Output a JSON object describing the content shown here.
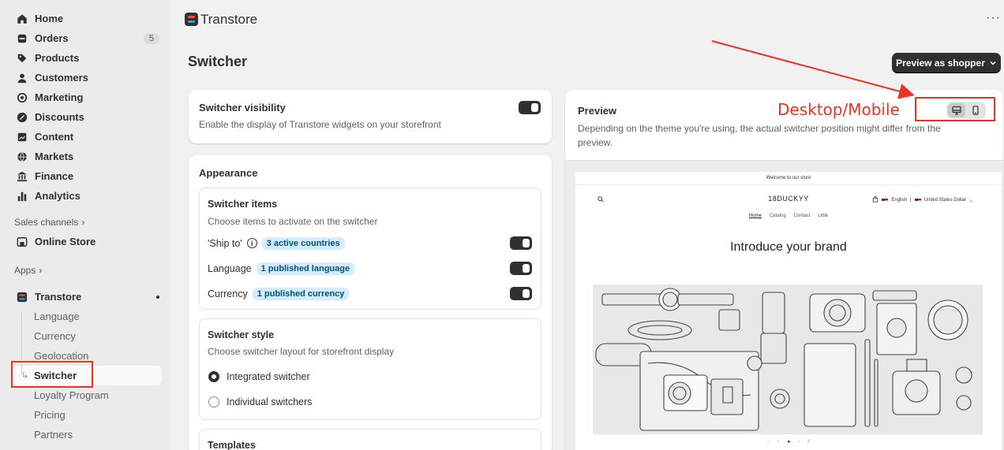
{
  "sidebar": {
    "items": [
      {
        "label": "Home",
        "icon": "home-icon"
      },
      {
        "label": "Orders",
        "icon": "orders-icon",
        "badge": "5"
      },
      {
        "label": "Products",
        "icon": "tag-icon"
      },
      {
        "label": "Customers",
        "icon": "person-icon"
      },
      {
        "label": "Marketing",
        "icon": "target-icon"
      },
      {
        "label": "Discounts",
        "icon": "discount-icon"
      },
      {
        "label": "Content",
        "icon": "content-icon"
      },
      {
        "label": "Markets",
        "icon": "globe-icon"
      },
      {
        "label": "Finance",
        "icon": "bank-icon"
      },
      {
        "label": "Analytics",
        "icon": "bar-chart-icon"
      }
    ],
    "sales_channels_label": "Sales channels",
    "online_store_label": "Online Store",
    "apps_label": "Apps",
    "app_name": "Transtore",
    "app_sub_items": [
      "Language",
      "Currency",
      "Geolocation",
      "Switcher",
      "Loyalty Program",
      "Pricing",
      "Partners"
    ]
  },
  "header": {
    "app_title": "Transtore",
    "more": "···"
  },
  "page": {
    "title": "Switcher",
    "preview_button": "Preview as shopper"
  },
  "visibility_card": {
    "title": "Switcher visibility",
    "desc": "Enable the display of Transtore widgets on your storefront"
  },
  "appearance": {
    "title": "Appearance",
    "items_card": {
      "title": "Switcher items",
      "desc": "Choose items to activate on the switcher",
      "rows": [
        {
          "label": "'Ship to'",
          "pill": "3 active countries"
        },
        {
          "label": "Language",
          "pill": "1 published language"
        },
        {
          "label": "Currency",
          "pill": "1 published currency"
        }
      ]
    },
    "style_card": {
      "title": "Switcher style",
      "desc": "Choose switcher layout for storefront display",
      "options": [
        "Integrated switcher",
        "Individual switchers"
      ]
    },
    "templates_title": "Templates"
  },
  "preview": {
    "title": "Preview",
    "desc": "Depending on the theme you're using, the actual switcher position might differ from the preview.",
    "store": {
      "banner": "Welcome to our store",
      "logo": "18DUCKYY",
      "language": "English",
      "currency": "United States Dollar",
      "nav": [
        "Home",
        "Catalog",
        "Contact",
        "Little"
      ],
      "hero_title": "Introduce your brand"
    }
  },
  "annotation": {
    "label": "Desktop/Mobile",
    "color": "#ea3323"
  }
}
